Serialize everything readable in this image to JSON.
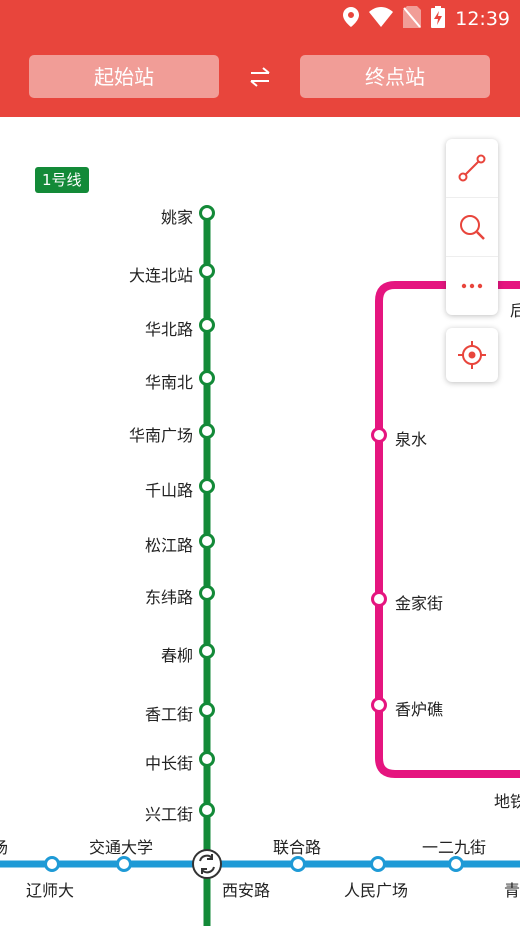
{
  "status_bar": {
    "time": "12:39",
    "icons": [
      "location-icon",
      "wifi-icon",
      "no-sim-icon",
      "battery-charging-icon"
    ]
  },
  "header": {
    "start_label": "起始站",
    "end_label": "终点站",
    "swap_icon": "swap-arrows-icon"
  },
  "colors": {
    "header": "#e8453c",
    "line1": "#138a38",
    "loop_line": "#e5157f",
    "horizontal_line": "#1e9ad6"
  },
  "map": {
    "line1_badge": "1号线",
    "line1_stations": [
      "姚家",
      "大连北站",
      "华北路",
      "华南北",
      "华南广场",
      "千山路",
      "松江路",
      "东纬路",
      "春柳",
      "香工街",
      "中长街",
      "兴工街"
    ],
    "loop_stations": [
      "泉水",
      "金家街",
      "香炉礁"
    ],
    "horizontal_labels_above": [
      "场",
      "交通大学",
      "联合路",
      "一二九街"
    ],
    "horizontal_labels_below": [
      "辽师大",
      "西安路",
      "人民广场",
      "青"
    ],
    "partial_labels": [
      "后",
      "地铁"
    ]
  },
  "tools": {
    "route_icon": "route-icon",
    "search_icon": "search-icon",
    "more_icon": "more-icon",
    "locate_icon": "locate-icon"
  }
}
